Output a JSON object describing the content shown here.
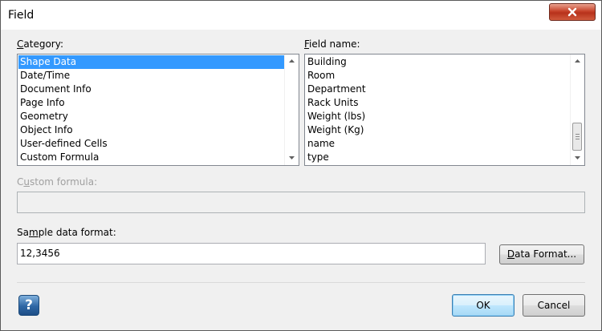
{
  "window": {
    "title": "Field",
    "close_icon": "close-icon",
    "close_color": "#c7432a"
  },
  "category": {
    "label_mnemonic": "C",
    "label_rest": "ategory:",
    "items": [
      "Shape Data",
      "Date/Time",
      "Document Info",
      "Page Info",
      "Geometry",
      "Object Info",
      "User-defined Cells",
      "Custom Formula"
    ],
    "selected": "Shape Data"
  },
  "field_name": {
    "label_mnemonic": "F",
    "label_rest": "ield name:",
    "items": [
      "Building",
      "Room",
      "Department",
      "Rack Units",
      "Weight (lbs)",
      "Weight (Kg)",
      "name",
      "type"
    ]
  },
  "custom_formula": {
    "label_pre": "C",
    "label_mnemonic": "u",
    "label_rest": "stom formula:",
    "value": ""
  },
  "sample": {
    "label_pre": "Sa",
    "label_mnemonic": "m",
    "label_rest": "ple data format:",
    "value": "12,3456"
  },
  "buttons": {
    "data_format_mnemonic": "D",
    "data_format_rest": "ata Format...",
    "ok": "OK",
    "cancel": "Cancel",
    "help_glyph": "?"
  },
  "colors": {
    "selection": "#3399ff",
    "dialog_bg": "#f0f0f0"
  }
}
